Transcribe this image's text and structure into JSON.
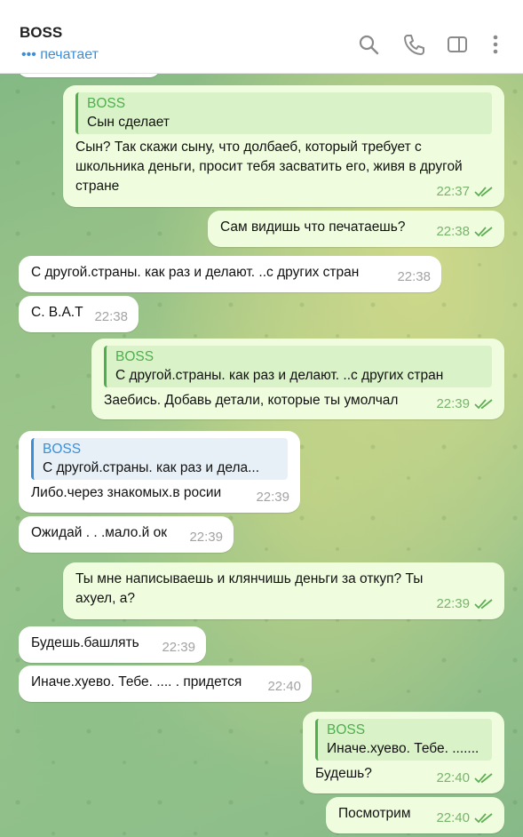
{
  "header": {
    "title": "BOSS",
    "status": "••• печатает"
  },
  "icons": {
    "search": "search-icon",
    "call": "phone-icon",
    "panel": "sidebar-icon",
    "more": "more-vertical-icon"
  },
  "colors": {
    "outgoing_bubble": "#effdde",
    "incoming_bubble": "#ffffff",
    "accent_green": "#4fae4e",
    "accent_blue": "#3a8fd9"
  },
  "messages": [
    {
      "dir": "out",
      "quote_name": "BOSS",
      "quote_text": "Сын сделает",
      "text": "Сын? Так скажи сыну, что долбаеб, который требует с школьника деньги, просит тебя засватить его, живя в другой стране",
      "time": "22:37"
    },
    {
      "dir": "out",
      "text": "Сам видишь что печатаешь?",
      "time": "22:38"
    },
    {
      "dir": "in",
      "text": "С другой.страны. как раз и делают. ..с других стран",
      "time": "22:38"
    },
    {
      "dir": "in",
      "text": "С. В.А.Т",
      "time": "22:38"
    },
    {
      "dir": "out",
      "quote_name": "BOSS",
      "quote_text": "С другой.страны. как раз и делают. ..с других стран",
      "text": "Заебись. Добавь детали, которые ты умолчал",
      "time": "22:39"
    },
    {
      "dir": "in",
      "quote_name": "BOSS",
      "quote_text": "С другой.страны. как раз и дела...",
      "text": "Либо.через знакомых.в росии",
      "time": "22:39"
    },
    {
      "dir": "in",
      "text": "Ожидай . . .мало.й ок",
      "time": "22:39"
    },
    {
      "dir": "out",
      "text": "Ты мне написываешь и клянчишь деньги за откуп? Ты ахуел, а?",
      "time": "22:39"
    },
    {
      "dir": "in",
      "text": "Будешь.башлять",
      "time": "22:39"
    },
    {
      "dir": "in",
      "text": "Иначе.хуево. Тебе. .... . придется",
      "time": "22:40"
    },
    {
      "dir": "out",
      "quote_name": "BOSS",
      "quote_text": "Иначе.хуево. Тебе. .......",
      "text": "Будешь?",
      "time": "22:40"
    },
    {
      "dir": "out",
      "text": "Посмотрим",
      "time": "22:40"
    }
  ]
}
